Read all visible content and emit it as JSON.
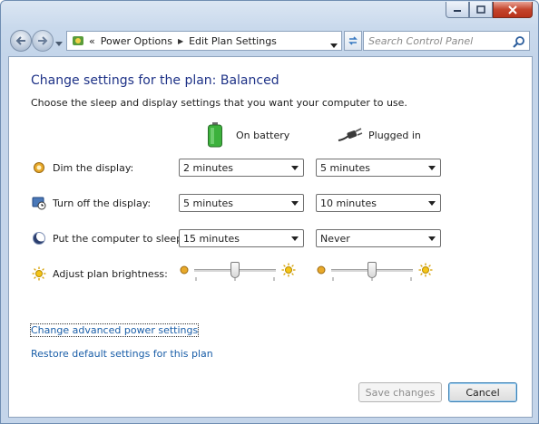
{
  "window": {
    "minimize_icon": "minimize-icon",
    "maximize_icon": "maximize-icon",
    "close_icon": "close-icon"
  },
  "nav": {
    "breadcrumb_prefix": "«",
    "breadcrumb": [
      "Power Options",
      "Edit Plan Settings"
    ],
    "search_placeholder": "Search Control Panel"
  },
  "page": {
    "title": "Change settings for the plan: Balanced",
    "subtitle": "Choose the sleep and display settings that you want your computer to use.",
    "col_battery": "On battery",
    "col_plugged": "Plugged in"
  },
  "settings": [
    {
      "label": "Dim the display:",
      "icon": "dim-display-icon",
      "battery": "2 minutes",
      "plugged": "5 minutes"
    },
    {
      "label": "Turn off the display:",
      "icon": "display-off-icon",
      "battery": "5 minutes",
      "plugged": "10 minutes"
    },
    {
      "label": "Put the computer to sleep:",
      "icon": "sleep-icon",
      "battery": "15 minutes",
      "plugged": "Never"
    }
  ],
  "brightness": {
    "label": "Adjust plan brightness:",
    "battery_level": 0.5,
    "plugged_level": 0.5
  },
  "links": {
    "advanced": "Change advanced power settings",
    "restore": "Restore default settings for this plan"
  },
  "buttons": {
    "save": "Save changes",
    "cancel": "Cancel"
  },
  "colors": {
    "title": "#1e3287",
    "link": "#1a5ea8"
  }
}
